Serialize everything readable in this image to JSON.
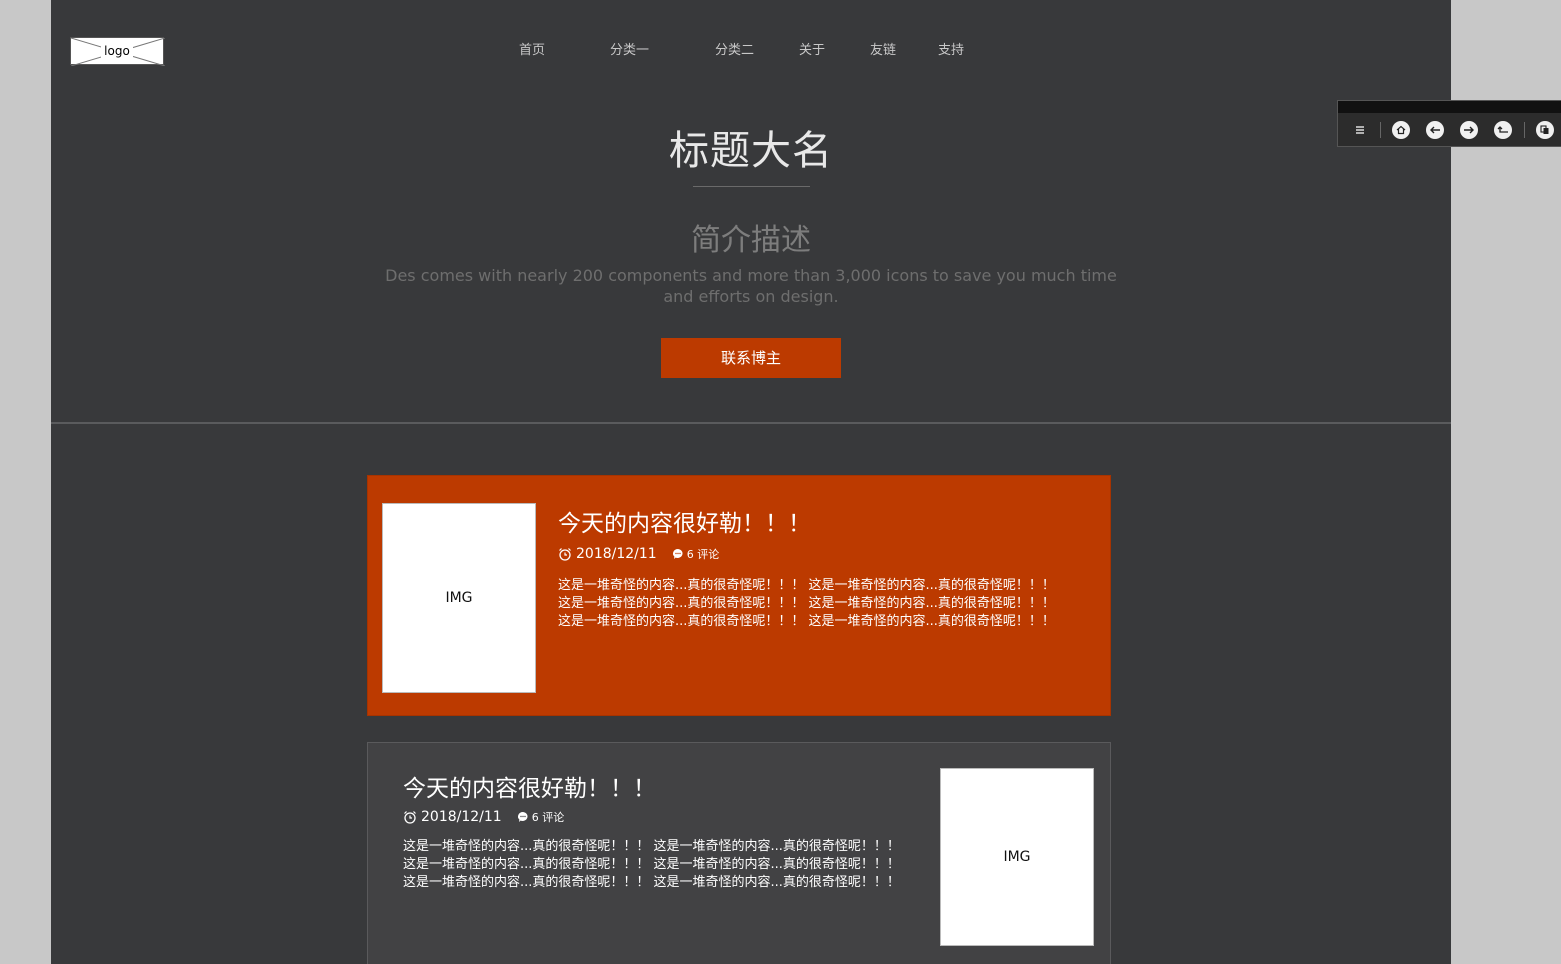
{
  "logo": {
    "text": "logo"
  },
  "nav": {
    "items": [
      {
        "label": "首页"
      },
      {
        "label": "分类一"
      },
      {
        "label": "分类二"
      },
      {
        "label": "关于"
      },
      {
        "label": "友链"
      },
      {
        "label": "支持"
      }
    ]
  },
  "hero": {
    "title": "标题大名",
    "subtitle": "简介描述",
    "description": "Des comes with nearly 200 components and more than 3,000 icons to save you much time and efforts on design.",
    "button_label": "联系博主"
  },
  "posts": [
    {
      "image_label": "IMG",
      "title": "今天的内容很好勒！！！",
      "date": "2018/12/11",
      "comments": "6 评论",
      "excerpt": "这是一堆奇怪的内容...真的很奇怪呢！！！ 这是一堆奇怪的内容...真的很奇怪呢！！！ 这是一堆奇怪的内容...真的很奇怪呢！！！ 这是一堆奇怪的内容...真的很奇怪呢！！！ 这是一堆奇怪的内容...真的很奇怪呢！！！ 这是一堆奇怪的内容...真的很奇怪呢！！！"
    },
    {
      "image_label": "IMG",
      "title": "今天的内容很好勒！！！",
      "date": "2018/12/11",
      "comments": "6 评论",
      "excerpt": "这是一堆奇怪的内容...真的很奇怪呢！！！ 这是一堆奇怪的内容...真的很奇怪呢！！！ 这是一堆奇怪的内容...真的很奇怪呢！！！ 这是一堆奇怪的内容...真的很奇怪呢！！！ 这是一堆奇怪的内容...真的很奇怪呢！！！ 这是一堆奇怪的内容...真的很奇怪呢！！！"
    }
  ],
  "colors": {
    "page_bg": "#38393b",
    "accent": "#bc3a00",
    "outer_bg": "#c8c8c8"
  },
  "toolbar": {
    "icons": [
      "menu-icon",
      "home-icon",
      "back-arrow-icon",
      "forward-arrow-icon",
      "return-icon",
      "copy-icon"
    ]
  }
}
